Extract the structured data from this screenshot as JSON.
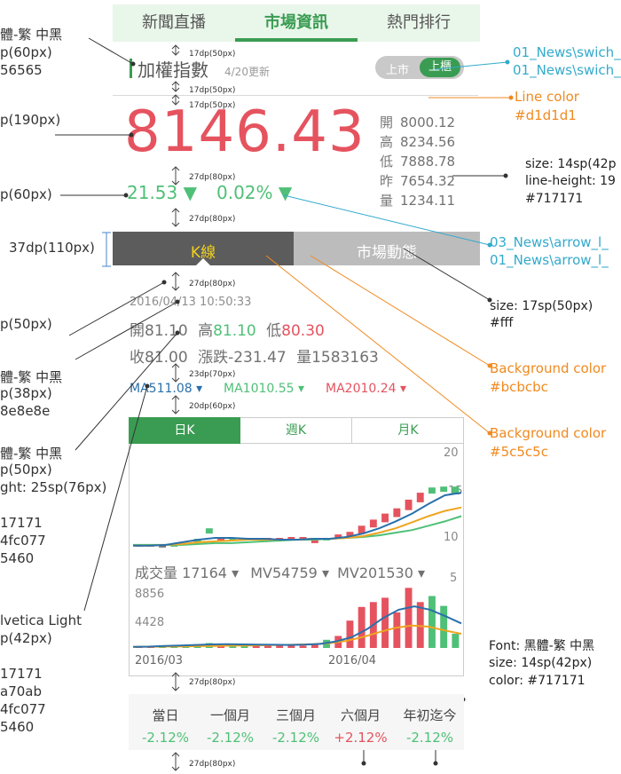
{
  "tabs": [
    "新聞直播",
    "市場資訊",
    "熱門排行"
  ],
  "index": {
    "title": "加權指數",
    "date": "4/20更新",
    "value": "8146.43",
    "change": "21.53",
    "change_pct": "0.02%"
  },
  "market_toggle": {
    "left": "上市",
    "right": "上櫃"
  },
  "ohlc": [
    {
      "label": "開",
      "value": "8000.12"
    },
    {
      "label": "高",
      "value": "8234.56"
    },
    {
      "label": "低",
      "value": "7888.78"
    },
    {
      "label": "昨",
      "value": "7654.32"
    },
    {
      "label": "量",
      "value": "1234.11"
    }
  ],
  "section_tabs": {
    "kline": "K線",
    "market": "市場動態"
  },
  "kline_info": {
    "timestamp": "2016/04/13 10:50:33",
    "open_label": "開",
    "open": "81.10",
    "high_label": "高",
    "high": "81.10",
    "low_label": "低",
    "low": "80.30",
    "close_label": "收",
    "close": "81.00",
    "change_label": "漲跌",
    "change": "-231.47",
    "volume_label": "量",
    "volume": "1583163"
  },
  "ma": [
    {
      "label": "MA5",
      "value": "11.08"
    },
    {
      "label": "MA10",
      "value": "10.55"
    },
    {
      "label": "MA20",
      "value": "10.24"
    }
  ],
  "period_tabs": [
    "日K",
    "週K",
    "月K"
  ],
  "price_axis": [
    "20",
    "15",
    "10",
    "5"
  ],
  "volume_header": {
    "vol": "成交量 17164",
    "mv5": "MV54759",
    "mv20": "MV201530"
  },
  "volume_axis": [
    "8856",
    "4428"
  ],
  "date_axis": [
    "2016/03",
    "2016/04"
  ],
  "ranges": [
    {
      "label": "當日",
      "value": "-2.12%"
    },
    {
      "label": "一個月",
      "value": "-2.12%"
    },
    {
      "label": "三個月",
      "value": "-2.12%"
    },
    {
      "label": "六個月",
      "value": "+2.12%"
    },
    {
      "label": "年初迄今",
      "value": "-2.12%"
    }
  ],
  "dims": {
    "d1": "17dp(50px)",
    "d2": "17dp(50px)",
    "d3": "17dp(50px)",
    "d4": "27dp(80px)",
    "d5": "27dp(80px)",
    "d6": "27dp(80px)",
    "d7": "23dp(70px)",
    "d8": "20dp(60px)",
    "d9": "27dp(80px)",
    "d10": "27dp(80px)"
  },
  "annotations": {
    "l1": "體-繁 中黑",
    "l2": "p(60px)",
    "l3": "56565",
    "l4": "p(190px)",
    "l5": "p(60px)",
    "l6": "37dp(110px)",
    "l7": "p(50px)",
    "l8": "體-繁 中黑",
    "l9": "p(38px)",
    "l10": "8e8e8e",
    "l11": "體-繁 中黑",
    "l12": "p(50px)",
    "l13": "ght: 25sp(76px)",
    "l14": "17171",
    "l15": "4fc077",
    "l16": "5460",
    "l17": "lvetica Light",
    "l18": "p(42px)",
    "l19": "17171",
    "l20": "a70ab",
    "l21": "4fc077",
    "l22": "5460",
    "r1": "01_News\\swich_",
    "r2": "01_News\\swich_",
    "r3": "Line color",
    "r4": "#d1d1d1",
    "r5": "size: 14sp(42p",
    "r6": "line-height: 19",
    "r7": "#717171",
    "r8": "03_News\\arrow_l_",
    "r9": "01_News\\arrow_l_",
    "r10": "size: 17sp(50px)",
    "r11": "#fff",
    "r12": "Background color",
    "r13": "#bcbcbc",
    "r14": "Background color",
    "r15": "#5c5c5c",
    "r16": "Font: 黑體-繁 中黑",
    "r17": "size: 14sp(42px)",
    "r18": "color: #717171"
  },
  "colors": {
    "green": "#4fc077",
    "red": "#e5535f",
    "gray": "#717171",
    "dark_tab": "#5c5c5c",
    "light_tab": "#bcbcbc",
    "line": "#d1d1d1"
  },
  "chart_data": {
    "type": "candlestick",
    "price_ylim": [
      5,
      20
    ],
    "candles": [
      {
        "o": 9.3,
        "c": 9.1,
        "dir": "down"
      },
      {
        "o": 9.3,
        "c": 9.1,
        "dir": "down"
      },
      {
        "o": 9.2,
        "c": 9.2,
        "dir": "flat"
      },
      {
        "o": 9.2,
        "c": 9.3,
        "dir": "up"
      },
      {
        "o": 9.5,
        "c": 9.3,
        "dir": "up"
      },
      {
        "o": 9.6,
        "c": 10.0,
        "dir": "up"
      },
      {
        "o": 10.6,
        "c": 11.2,
        "dir": "up"
      },
      {
        "o": 10.2,
        "c": 9.8,
        "dir": "down"
      },
      {
        "o": 9.8,
        "c": 10.0,
        "dir": "up"
      },
      {
        "o": 9.9,
        "c": 10.0,
        "dir": "up"
      },
      {
        "o": 10.1,
        "c": 9.9,
        "dir": "down"
      },
      {
        "o": 10.1,
        "c": 9.9,
        "dir": "down"
      },
      {
        "o": 10.1,
        "c": 9.9,
        "dir": "down"
      },
      {
        "o": 10.2,
        "c": 9.9,
        "dir": "down"
      },
      {
        "o": 10.2,
        "c": 10.0,
        "dir": "down"
      },
      {
        "o": 10.1,
        "c": 9.5,
        "dir": "down"
      },
      {
        "o": 9.8,
        "c": 10.1,
        "dir": "up"
      },
      {
        "o": 10.5,
        "c": 10.1,
        "dir": "down"
      },
      {
        "o": 10.8,
        "c": 10.2,
        "dir": "down"
      },
      {
        "o": 11.5,
        "c": 10.6,
        "dir": "down"
      },
      {
        "o": 12.2,
        "c": 11.3,
        "dir": "down"
      },
      {
        "o": 12.9,
        "c": 11.9,
        "dir": "down"
      },
      {
        "o": 13.5,
        "c": 12.5,
        "dir": "down"
      },
      {
        "o": 14.5,
        "c": 13.3,
        "dir": "down"
      },
      {
        "o": 15.3,
        "c": 14.2,
        "dir": "down"
      },
      {
        "o": 15.2,
        "c": 15.9,
        "dir": "up"
      },
      {
        "o": 15.4,
        "c": 16.0,
        "dir": "up"
      },
      {
        "o": 15.2,
        "c": 16.0,
        "dir": "up"
      }
    ],
    "ma5": [
      9.2,
      9.2,
      9.3,
      9.6,
      9.9,
      10.1,
      10.1,
      10.0,
      10.0,
      9.9,
      9.9,
      10.0,
      10.0,
      10.2,
      10.6,
      11.2,
      12.0,
      12.9,
      14.0,
      15.0,
      15.3
    ],
    "ma10": [
      9.2,
      9.2,
      9.3,
      9.4,
      9.6,
      9.7,
      9.8,
      9.9,
      9.9,
      9.9,
      9.9,
      10.0,
      10.0,
      10.1,
      10.3,
      10.7,
      11.2,
      11.9,
      12.6,
      13.2,
      13.6
    ],
    "ma20": [
      9.3,
      9.3,
      9.3,
      9.3,
      9.4,
      9.5,
      9.5,
      9.6,
      9.7,
      9.8,
      9.9,
      9.9,
      10.0,
      10.1,
      10.2,
      10.4,
      10.7,
      11.0,
      11.5,
      12.0,
      12.6
    ],
    "volume_ylim": [
      0,
      13000
    ],
    "volumes": [
      300,
      300,
      400,
      300,
      400,
      600,
      900,
      500,
      700,
      600,
      500,
      600,
      700,
      600,
      400,
      800,
      1500,
      2200,
      5000,
      7500,
      8400,
      9200,
      6500,
      11000,
      8400,
      9500,
      7700,
      2600
    ],
    "mv5": [
      200,
      250,
      350,
      450,
      550,
      650,
      700,
      650,
      600,
      580,
      550,
      600,
      750,
      1200,
      2000,
      3500,
      5500,
      7000,
      7600,
      7000,
      5800,
      4500
    ],
    "mv20": [
      200,
      220,
      260,
      300,
      340,
      380,
      420,
      460,
      500,
      560,
      620,
      700,
      900,
      1300,
      2000,
      2900,
      3700,
      4100,
      3900,
      3200,
      2600
    ]
  }
}
